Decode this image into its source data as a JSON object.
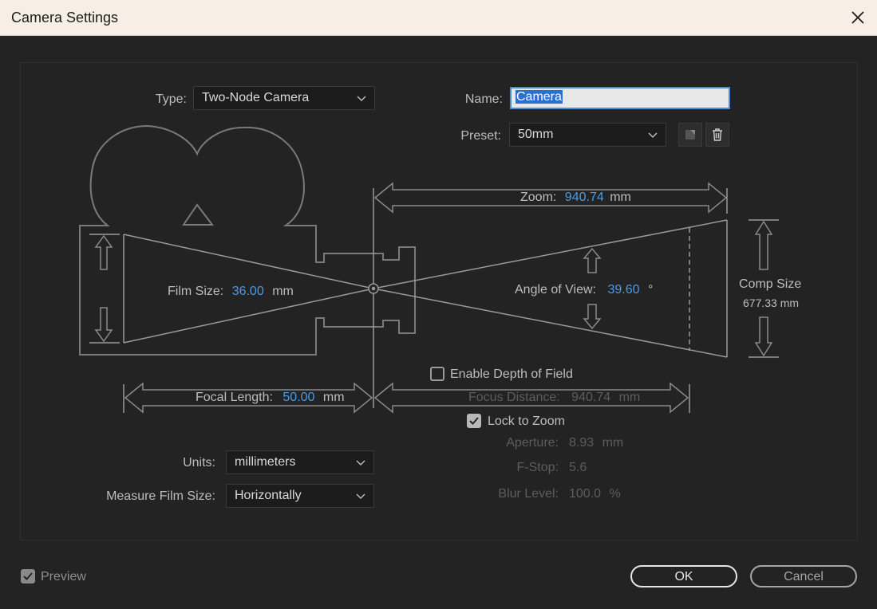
{
  "window": {
    "title": "Camera Settings"
  },
  "type": {
    "label": "Type:",
    "value": "Two-Node Camera"
  },
  "name": {
    "label": "Name:",
    "value": "Camera"
  },
  "preset": {
    "label": "Preset:",
    "value": "50mm"
  },
  "zoom": {
    "label": "Zoom:",
    "value": "940.74",
    "unit": "mm"
  },
  "film_size": {
    "label": "Film Size:",
    "value": "36.00",
    "unit": "mm"
  },
  "angle_of_view": {
    "label": "Angle of View:",
    "value": "39.60",
    "unit": "°"
  },
  "comp_size": {
    "label": "Comp Size",
    "value": "677.33 mm"
  },
  "focal_length": {
    "label": "Focal Length:",
    "value": "50.00",
    "unit": "mm"
  },
  "depth_of_field": {
    "enable_label": "Enable Depth of Field",
    "enabled": false,
    "focus_distance": {
      "label": "Focus Distance:",
      "value": "940.74",
      "unit": "mm"
    },
    "lock_to_zoom": {
      "label": "Lock to Zoom",
      "checked": true
    },
    "aperture": {
      "label": "Aperture:",
      "value": "8.93",
      "unit": "mm"
    },
    "f_stop": {
      "label": "F-Stop:",
      "value": "5.6"
    },
    "blur_level": {
      "label": "Blur Level:",
      "value": "100.0",
      "unit": "%"
    }
  },
  "units": {
    "label": "Units:",
    "value": "millimeters"
  },
  "measure_film_size": {
    "label": "Measure Film Size:",
    "value": "Horizontally"
  },
  "preview": {
    "label": "Preview",
    "checked": true
  },
  "buttons": {
    "ok": "OK",
    "cancel": "Cancel"
  },
  "colors": {
    "value_blue": "#4a9ce8",
    "background": "#232323",
    "diagram_lines": "#7a7a7a"
  }
}
